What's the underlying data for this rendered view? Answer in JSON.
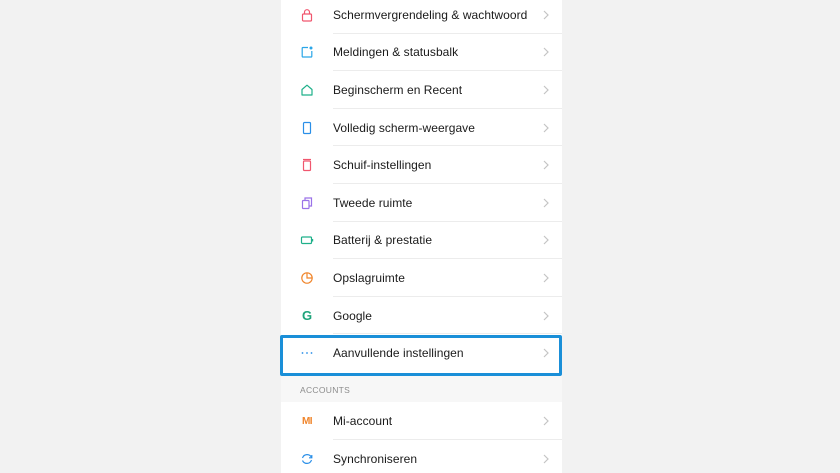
{
  "settings": {
    "items": [
      {
        "label": "Schermvergrendeling & wachtwoord",
        "icon": "lock-icon",
        "color": "#f0566e"
      },
      {
        "label": "Meldingen & statusbalk",
        "icon": "notification-icon",
        "color": "#2aa6e8"
      },
      {
        "label": "Beginscherm en Recent",
        "icon": "home-icon",
        "color": "#1fb08a"
      },
      {
        "label": "Volledig scherm-weergave",
        "icon": "fullscreen-icon",
        "color": "#2a8fe8"
      },
      {
        "label": "Schuif-instellingen",
        "icon": "slider-icon",
        "color": "#f0566e"
      },
      {
        "label": "Tweede ruimte",
        "icon": "second-space-icon",
        "color": "#9a72e8"
      },
      {
        "label": "Batterij & prestatie",
        "icon": "battery-icon",
        "color": "#1fb08a"
      },
      {
        "label": "Opslagruimte",
        "icon": "storage-icon",
        "color": "#f0852b"
      },
      {
        "label": "Google",
        "icon": "google-icon",
        "glyph": "G",
        "color": "#1ea37a"
      },
      {
        "label": "Aanvullende instellingen",
        "icon": "more-icon",
        "color": "#2a8fe8"
      }
    ],
    "section_header": "ACCOUNTS",
    "accounts": [
      {
        "label": "Mi-account",
        "icon": "mi-icon",
        "glyph": "MI",
        "color": "#f0852b"
      },
      {
        "label": "Synchroniseren",
        "icon": "sync-icon",
        "color": "#2a8fe8"
      }
    ],
    "chevron_icon": "chevron-right-icon",
    "highlight_color": "#1a8fd8"
  }
}
